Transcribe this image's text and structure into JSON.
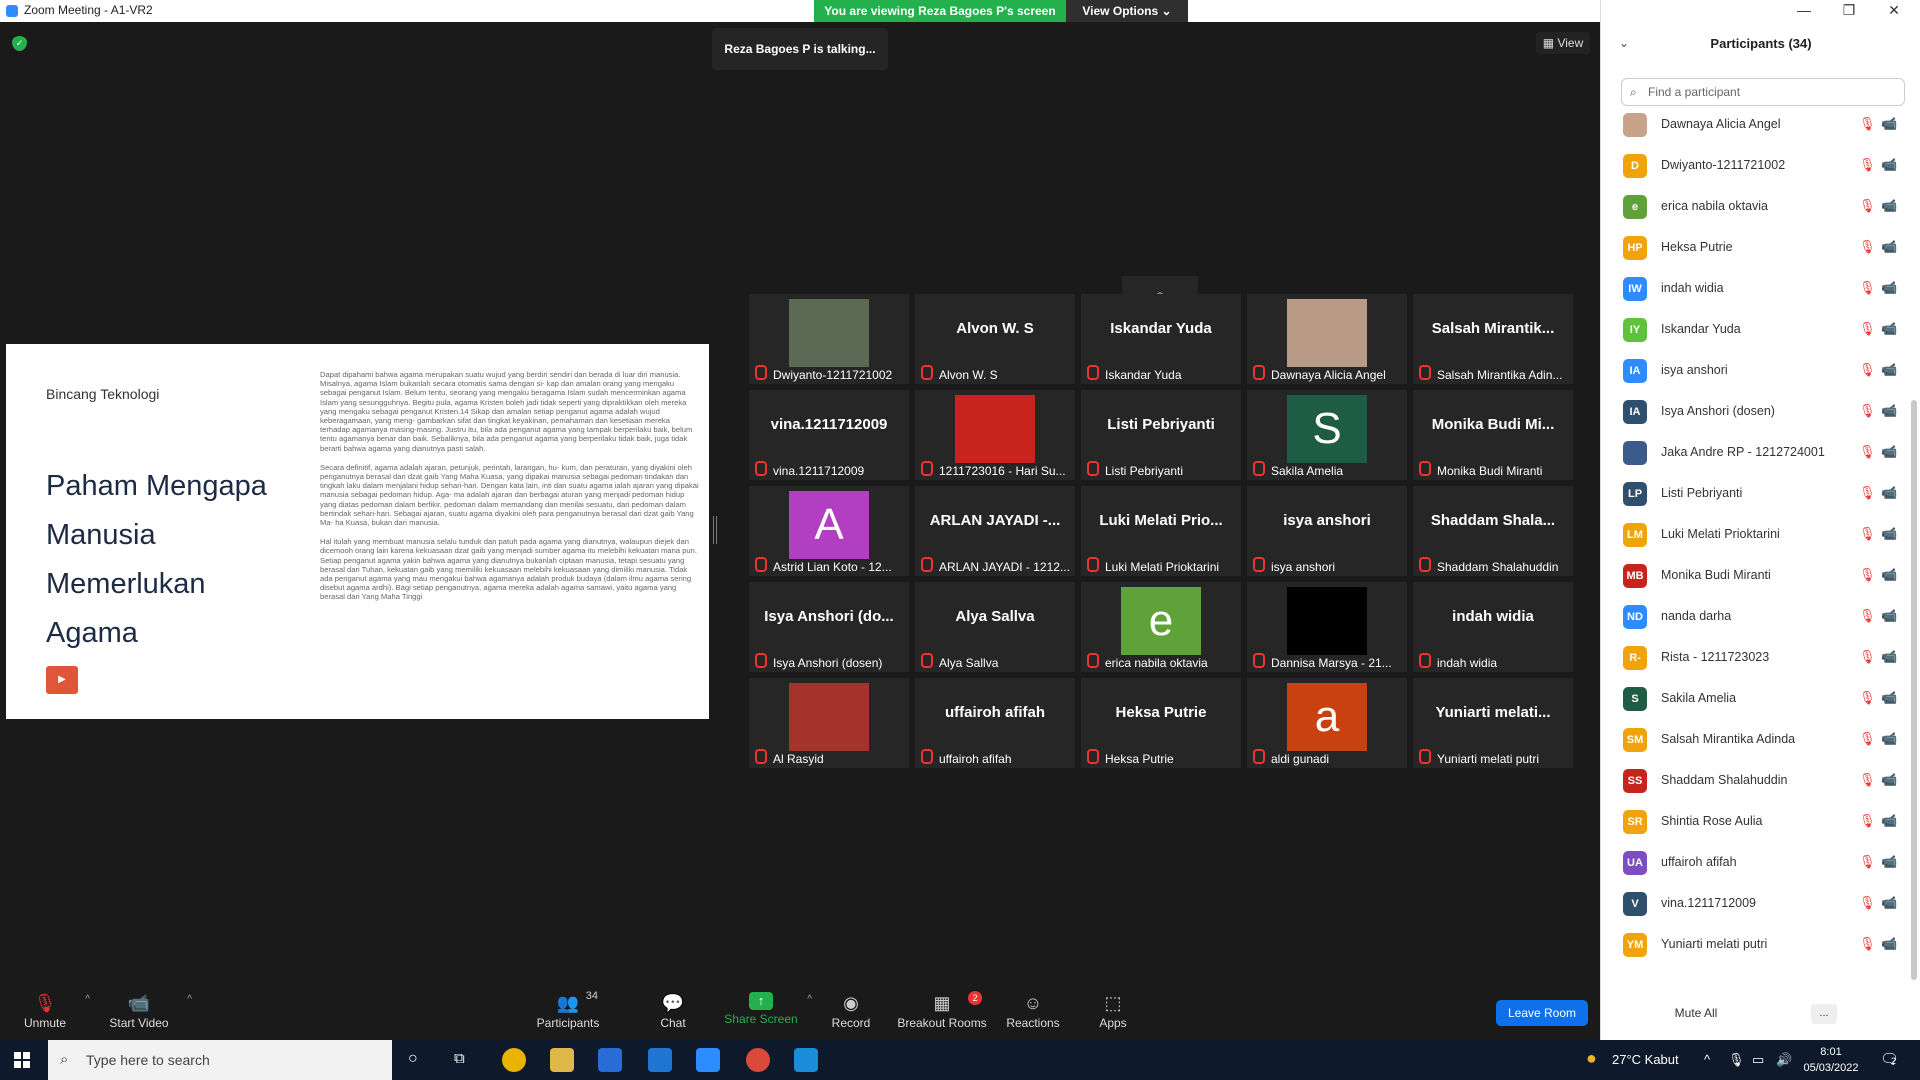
{
  "window": {
    "title": "Zoom Meeting - A1-VR2",
    "viewing_banner": "You are viewing Reza Bagoes P's screen",
    "view_options": "View Options"
  },
  "meeting": {
    "talking": "Reza Bagoes P is talking...",
    "view_label": "View"
  },
  "slide": {
    "brand": "Bincang Teknologi",
    "heading_lines": [
      "Paham Mengapa",
      "Manusia",
      "Memerlukan",
      "Agama"
    ],
    "paragraphs": [
      "Dapat dipahami bahwa agama merupakan suatu wujud yang berdiri sendiri dan berada di luar diri manusia. Misalnya, agama Islam bukanlah secara otomatis sama dengan si- kap dan amalan orang yang mengaku sebagai penganut Islam. Belum tentu, seorang yang mengaku beragama Islam sudah mencerminkan agama Islam yang sesungguhnya. Begitu pula, agama Kristen boleh jadi tidak seperti yang dipraktikkan oleh mereka yang mengaku sebagai penganut Kristen.14 Sikap dan amalan setiap penganut agama adalah wujud keberagamaan, yang meng- gambarkan sifat dan tingkat keyakinan, pemahaman dan kesetiaan mereka terhadap agamanya masing-masing. Justru itu, bila ada penganut agama yang tampak berperilaku baik, belum tentu agamanya benar dan baik. Sebaliknya, bila ada penganut agama yang berperilaku tidak baik, juga tidak berarti bahwa agama yang dianutnya pasti salah.",
      "Secara definitif, agama adalah ajaran, petunjuk, perintah, larangan, hu- kum, dan peraturan, yang diyakini oleh penganutnya berasal dari dzat gaib Yang Maha Kuasa, yang dipakai manusia sebagai pedoman tindakan dan tingkah laku dalam menjalani hidup sehari-hari. Dengan kata lain, inti dan suatu agama ialah ajaran yang dipakai manusia sebagai pedoman hidup. Aga- ma adalah ajaran dan berbagai aturan yang menjadi pedoman hidup yang diatas pedoman dalam berfikir, pedoman dalam memandang dan menilai sesuatu, dari pedoman dalam bertindak sehari-hari. Sebagai ajaran, suatu agama diyakini oleh para penganutnya berasal dari dzat gaib Yang Ma- ha Kuasa, bukan dari manusia.",
      "Hal itulah yang membuat manusia selalu tunduk dan patuh pada agama yang dianutnya, walaupun diejek dan dicemooh orang lain karena kekuasaan dzat gaib yang menjadi sumber agama itu melebihi kekuatan mana pun. Setiap penganut agama yakin bahwa agama yang dianutnya bukanlah ciptaan manusia, tetapi sesuatu yang berasal dari Tuhan, kekuatan gaib yang memiliki kekuasaan melebihi kekuasaan yang dimiliki manusia. Tidak ada penganut agama yang mau mengakui bahwa agamanya adalah produk budaya (dalam ilmu agama sering disebut agama ardhi). Bagi setiap penganutnya, agama mereka adalah agama samawi, yaitu agama yang berasal dari Yang Maha Tinggi"
    ]
  },
  "gallery": [
    {
      "label": "Dwiyanto-1211721002",
      "big": "",
      "kind": "photo",
      "color": "#5a6a55"
    },
    {
      "label": "Alvon W. S",
      "big": "Alvon W. S",
      "kind": "name"
    },
    {
      "label": "Iskandar Yuda",
      "big": "Iskandar Yuda",
      "kind": "name"
    },
    {
      "label": "Dawnaya Alicia Angel",
      "big": "",
      "kind": "photo",
      "color": "#b89a86"
    },
    {
      "label": "Salsah Mirantika Adin...",
      "big": "Salsah  Mirantik...",
      "kind": "name"
    },
    {
      "label": "vina.1211712009",
      "big": "vina.1211712009",
      "kind": "name"
    },
    {
      "label": "1211723016 - Hari Su...",
      "big": "",
      "kind": "photo",
      "color": "#c8241e"
    },
    {
      "label": "Listi Pebriyanti",
      "big": "Listi Pebriyanti",
      "kind": "name"
    },
    {
      "label": "Sakila Amelia",
      "big": "S",
      "kind": "letter",
      "color": "#1f5c46"
    },
    {
      "label": "Monika Budi Miranti",
      "big": "Monika  Budi  Mi...",
      "kind": "name"
    },
    {
      "label": "Astrid Lian Koto - 12...",
      "big": "A",
      "kind": "letter",
      "color": "#b23fc1"
    },
    {
      "label": "ARLAN JAYADI - 1212...",
      "big": "ARLAN JAYADI -...",
      "kind": "name"
    },
    {
      "label": "Luki Melati Prioktarini",
      "big": "Luki  Melati  Prio...",
      "kind": "name"
    },
    {
      "label": "isya anshori",
      "big": "isya anshori",
      "kind": "name"
    },
    {
      "label": "Shaddam Shalahuddin",
      "big": "Shaddam  Shala...",
      "kind": "name"
    },
    {
      "label": "Isya Anshori (dosen)",
      "big": "Isya Anshori (do...",
      "kind": "name"
    },
    {
      "label": "Alya Sallva",
      "big": "Alya Sallva",
      "kind": "name"
    },
    {
      "label": "erica nabila oktavia",
      "big": "e",
      "kind": "letter",
      "color": "#5fa23a"
    },
    {
      "label": "Dannisa Marsya - 21...",
      "big": "",
      "kind": "photo",
      "color": "#000000"
    },
    {
      "label": "indah widia",
      "big": "indah widia",
      "kind": "name"
    },
    {
      "label": "Al Rasyid",
      "big": "",
      "kind": "photo",
      "color": "#a4332c"
    },
    {
      "label": "uffairoh afifah",
      "big": "uffairoh afifah",
      "kind": "name"
    },
    {
      "label": "Heksa Putrie",
      "big": "Heksa Putrie",
      "kind": "name"
    },
    {
      "label": "aldi gunadi",
      "big": "a",
      "kind": "letter",
      "color": "#c8410e"
    },
    {
      "label": "Yuniarti melati putri",
      "big": "Yuniarti  melati...",
      "kind": "name"
    }
  ],
  "toolbar": {
    "unmute": "Unmute",
    "start_video": "Start Video",
    "participants": "Participants",
    "participants_count": "34",
    "chat": "Chat",
    "share_screen": "Share Screen",
    "record": "Record",
    "breakout_rooms": "Breakout Rooms",
    "breakout_badge": "2",
    "reactions": "Reactions",
    "apps": "Apps",
    "leave_room": "Leave Room"
  },
  "panel": {
    "title": "Participants (34)",
    "search_placeholder": "Find a participant",
    "mute_all": "Mute All",
    "more": "...",
    "participants": [
      {
        "initials": "",
        "name": "Dawnaya Alicia Angel",
        "color": "#c9a28a",
        "video_on": false
      },
      {
        "initials": "D",
        "name": "Dwiyanto-1211721002",
        "color": "#f0a30a",
        "video_on": true
      },
      {
        "initials": "e",
        "name": "erica nabila oktavia",
        "color": "#5fa23a",
        "video_on": false
      },
      {
        "initials": "HP",
        "name": "Heksa Putrie",
        "color": "#f0a30a",
        "video_on": false
      },
      {
        "initials": "IW",
        "name": "indah widia",
        "color": "#2d8cff",
        "video_on": false
      },
      {
        "initials": "IY",
        "name": "Iskandar Yuda",
        "color": "#5fc23a",
        "video_on": false
      },
      {
        "initials": "IA",
        "name": "isya anshori",
        "color": "#2d8cff",
        "video_on": false
      },
      {
        "initials": "IA",
        "name": "Isya Anshori (dosen)",
        "color": "#2f4f6f",
        "video_on": false
      },
      {
        "initials": "",
        "name": "Jaka Andre RP - 1212724001",
        "color": "#3b5b8a",
        "video_on": true
      },
      {
        "initials": "LP",
        "name": "Listi Pebriyanti",
        "color": "#2f4f6f",
        "video_on": false
      },
      {
        "initials": "LM",
        "name": "Luki Melati Prioktarini",
        "color": "#f0a30a",
        "video_on": false
      },
      {
        "initials": "MB",
        "name": "Monika Budi Miranti",
        "color": "#c8241e",
        "video_on": false
      },
      {
        "initials": "ND",
        "name": "nanda darha",
        "color": "#2d8cff",
        "video_on": true
      },
      {
        "initials": "R-",
        "name": "Rista - 1211723023",
        "color": "#f0a30a",
        "video_on": true
      },
      {
        "initials": "S",
        "name": "Sakila Amelia",
        "color": "#1f5c46",
        "video_on": false
      },
      {
        "initials": "SM",
        "name": "Salsah Mirantika Adinda",
        "color": "#f0a30a",
        "video_on": false
      },
      {
        "initials": "SS",
        "name": "Shaddam Shalahuddin",
        "color": "#c8241e",
        "video_on": false
      },
      {
        "initials": "SR",
        "name": "Shintia Rose Aulia",
        "color": "#f0a30a",
        "video_on": true
      },
      {
        "initials": "UA",
        "name": "uffairoh afifah",
        "color": "#7b4fc1",
        "video_on": false
      },
      {
        "initials": "V",
        "name": "vina.1211712009",
        "color": "#2f4f6f",
        "video_on": false
      },
      {
        "initials": "YM",
        "name": "Yuniarti melati putri",
        "color": "#f0a30a",
        "video_on": false
      }
    ]
  },
  "taskbar": {
    "search_placeholder": "Type here to search",
    "weather": "27°C  Kabut",
    "time": "8:01",
    "date": "05/03/2022",
    "notifications": "2"
  }
}
